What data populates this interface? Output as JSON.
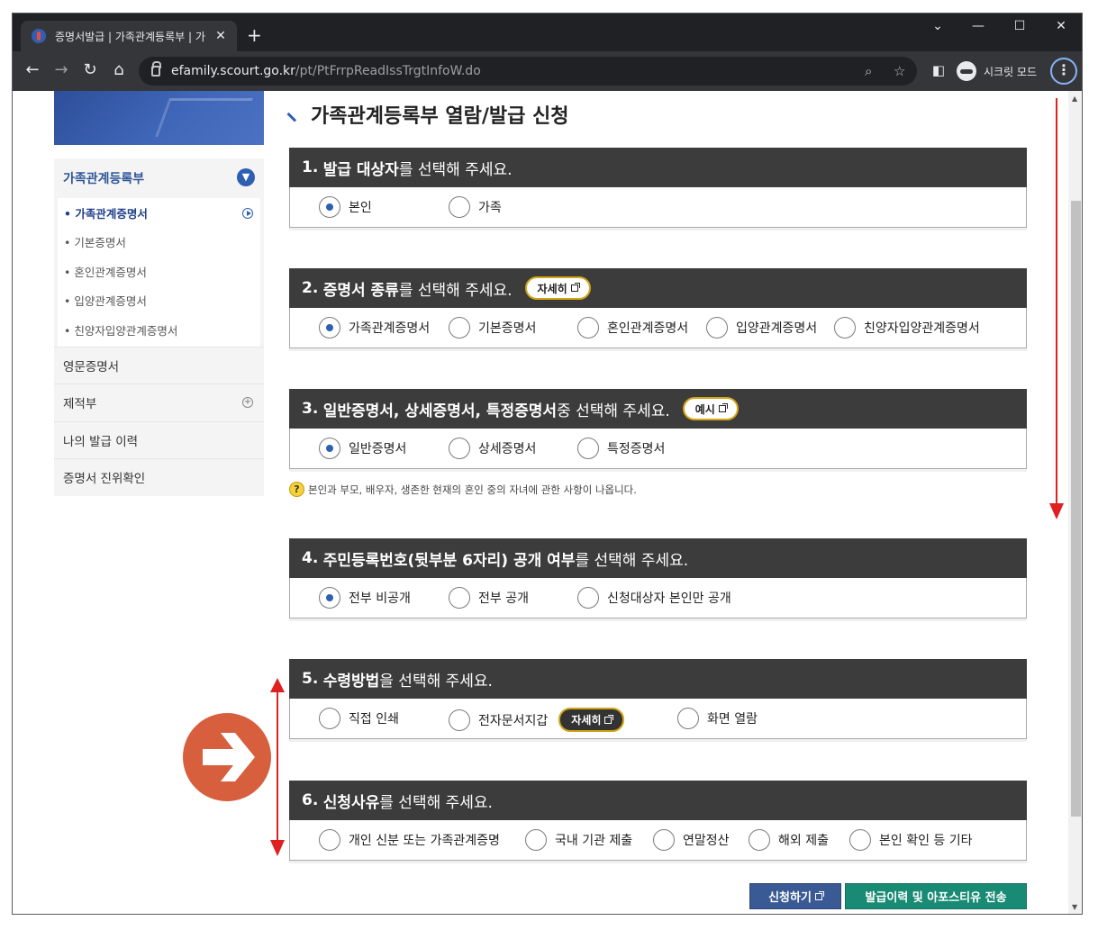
{
  "browser": {
    "tab_title": "증명서발급 | 가족관계등록부 | 가",
    "tab_close": "✕",
    "new_tab": "+",
    "url_host": "efamily.scourt.go.kr",
    "url_path": "/pt/PtFrrpReadIssTrgtInfoW.do",
    "profile_label": "시크릿 모드",
    "window_controls": [
      "⌄",
      "—",
      "☐",
      "✕"
    ]
  },
  "sidebar": {
    "section_title": "가족관계등록부",
    "sub_items": [
      {
        "label": "• 가족관계증명서",
        "active": true
      },
      {
        "label": "• 기본증명서"
      },
      {
        "label": "• 혼인관계증명서"
      },
      {
        "label": "• 입양관계증명서"
      },
      {
        "label": "• 친양자입양관계증명서"
      }
    ],
    "rows": [
      "영문증명서",
      "제적부",
      "나의 발급 이력",
      "증명서 진위확인"
    ]
  },
  "main": {
    "page_title": "가족관계등록부 열람/발급 신청",
    "sections": [
      {
        "num": "1.",
        "bold": "발급 대상자",
        "rest": "를 선택해 주세요.",
        "options": [
          {
            "label": "본인",
            "checked": true
          },
          {
            "label": "가족",
            "checked": false
          }
        ]
      },
      {
        "num": "2.",
        "bold": "증명서 종류",
        "rest": "를 선택해 주세요.",
        "pill": "자세히",
        "options": [
          {
            "label": "가족관계증명서",
            "checked": true
          },
          {
            "label": "기본증명서",
            "checked": false
          },
          {
            "label": "혼인관계증명서",
            "checked": false
          },
          {
            "label": "입양관계증명서",
            "checked": false
          },
          {
            "label": "친양자입양관계증명서",
            "checked": false
          }
        ]
      },
      {
        "num": "3.",
        "bold": "일반증명서, 상세증명서, 특정증명서",
        "rest": " 중 선택해 주세요.",
        "pill": "예시",
        "options": [
          {
            "label": "일반증명서",
            "checked": true
          },
          {
            "label": "상세증명서",
            "checked": false
          },
          {
            "label": "특정증명서",
            "checked": false
          }
        ]
      },
      {
        "num": "4.",
        "bold": "주민등록번호(뒷부분 6자리) 공개 여부",
        "rest": "를 선택해 주세요.",
        "options": [
          {
            "label": "전부 비공개",
            "checked": true
          },
          {
            "label": "전부 공개",
            "checked": false
          },
          {
            "label": "신청대상자 본인만 공개",
            "checked": false
          }
        ]
      },
      {
        "num": "5.",
        "bold": "수령방법",
        "rest": "을 선택해 주세요.",
        "inline_pill": "자세히",
        "options": [
          {
            "label": "직접 인쇄",
            "checked": false
          },
          {
            "label": "전자문서지갑",
            "checked": false
          },
          {
            "label": "화면 열람",
            "checked": false
          }
        ]
      },
      {
        "num": "6.",
        "bold": "신청사유",
        "rest": "를 선택해 주세요.",
        "options": [
          {
            "label": "개인 신분 또는 가족관계증명",
            "checked": false
          },
          {
            "label": "국내 기관 제출",
            "checked": false
          },
          {
            "label": "연말정산",
            "checked": false
          },
          {
            "label": "해외 제출",
            "checked": false
          },
          {
            "label": "본인 확인 등 기타",
            "checked": false
          }
        ]
      }
    ],
    "note_text": "본인과 부모, 배우자, 생존한 현재의 혼인 중의 자녀에 관한 사항이 나옵니다.",
    "buttons": {
      "apply": "신청하기",
      "send": "발급이력 및 아포스티유 전송"
    }
  },
  "colors": {
    "section_header": "#3c3c3c",
    "accent_blue": "#2f5fb3",
    "pill_border": "#d2a418",
    "apply_button": "#3a5a95",
    "send_button": "#198a73",
    "annotation_red": "#e02020",
    "annotation_orange": "#d75f3e"
  }
}
